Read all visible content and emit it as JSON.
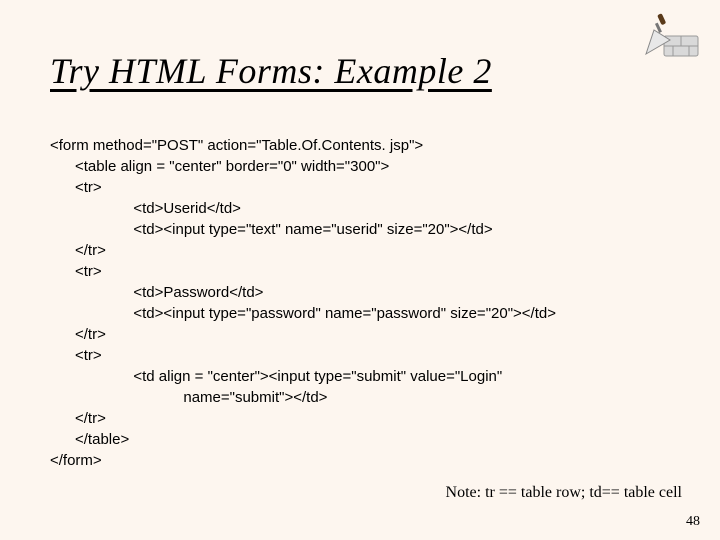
{
  "title": "Try HTML Forms: Example 2",
  "code": "<form method=\"POST\" action=\"Table.Of.Contents. jsp\">\n      <table align = \"center\" border=\"0\" width=\"300\">\n      <tr>\n                    <td>Userid</td>\n                    <td><input type=\"text\" name=\"userid\" size=\"20\"></td>\n      </tr>\n      <tr>\n                    <td>Password</td>\n                    <td><input type=\"password\" name=\"password\" size=\"20\"></td>\n      </tr>\n      <tr>\n                    <td align = \"center\"><input type=\"submit\" value=\"Login\"\n                                name=\"submit\"></td>\n      </tr>\n      </table>\n</form>",
  "note": "Note:  tr == table row;  td== table cell",
  "pagenum": "48"
}
